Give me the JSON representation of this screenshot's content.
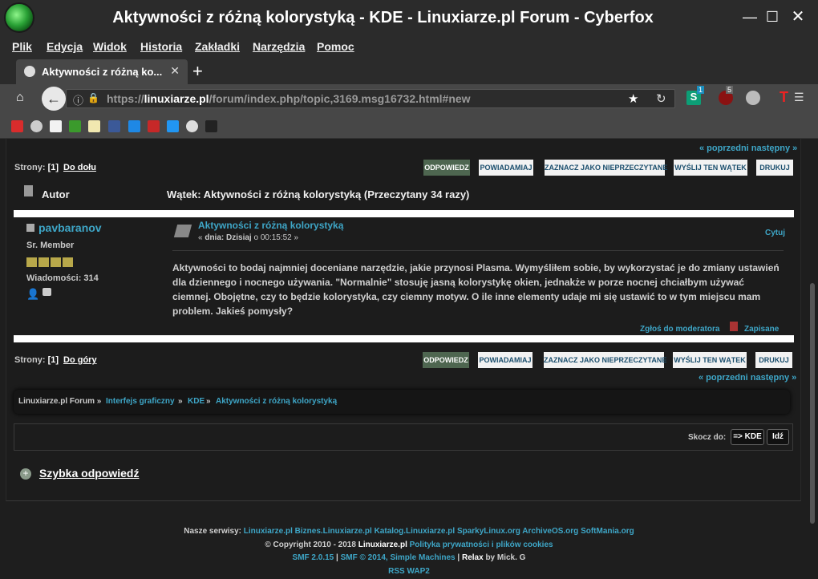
{
  "window": {
    "title": "Aktywności z różną kolorystyką - KDE - Linuxiarze.pl Forum - Cyberfox"
  },
  "menu": [
    "Plik",
    "Edycja",
    "Widok",
    "Historia",
    "Zakładki",
    "Narzędzia",
    "Pomoc"
  ],
  "tab": {
    "label": "Aktywności z różną ko...",
    "close": "✕",
    "new": "+"
  },
  "url": {
    "prefix": "https://",
    "host": "linuxiarze.pl",
    "path": "/forum/index.php/topic,3169.msg16732.html#new"
  },
  "extensions": {
    "badge1": "1",
    "badge2": "5"
  },
  "nav_links": {
    "prev_next": "« poprzedni następny »"
  },
  "pages": {
    "label": "Strony:",
    "current": "[1]",
    "down": "Do dołu",
    "up": "Do góry"
  },
  "buttons": [
    "ODPOWIEDZ",
    "POWIADAMIAJ",
    "ZAZNACZ JAKO NIEPRZECZYTANE",
    "WYŚLIJ TEN WĄTEK",
    "DRUKUJ"
  ],
  "thread": {
    "author_header": "Autor",
    "title": "Wątek: Aktywności z różną kolorystyką  (Przeczytany 34 razy)"
  },
  "post": {
    "author": "pavbaranov",
    "rank": "Sr. Member",
    "messages": "Wiadomości: 314",
    "subject": "Aktywności z różną kolorystyką",
    "date_prefix": "« ",
    "date_bold": "dnia: Dzisiaj",
    "date_rest": " o 00:15:52 »",
    "quote": "Cytuj",
    "body": "Aktywności to bodaj najmniej doceniane narzędzie, jakie przynosi Plasma. Wymyśliłem sobie, by wykorzystać je do zmiany ustawień dla dziennego i nocnego używania. \"Normalnie\" stosuję jasną kolorystykę okien, jednakże w porze nocnej chciałbym używać ciemnej. Obojętne, czy to będzie kolorystyka, czy ciemny motyw. O ile inne elementy udaje mi się ustawić to w tym miejscu mam problem. Jakieś pomysły?",
    "report": "Zgłoś do moderatora",
    "logged": "Zapisane"
  },
  "breadcrumb": {
    "root": "Linuxiarze.pl Forum »",
    "items": [
      "Interfejs graficzny",
      "»",
      "KDE",
      "»",
      "Aktywności z różną kolorystyką"
    ]
  },
  "jump": {
    "label": "Skocz do:",
    "select": "=> KDE",
    "go": "Idź"
  },
  "quick_reply": "Szybka odpowiedź",
  "footer": {
    "sites_label": "Nasze serwisy:",
    "sites": [
      "Linuxiarze.pl",
      "Biznes.Linuxiarze.pl",
      "Katalog.Linuxiarze.pl",
      "SparkyLinux.org",
      "ArchiveOS.org",
      "SoftMania.org"
    ],
    "copyright": "© Copyright 2010 - 2018",
    "brand": "Linuxiarze.pl",
    "privacy": "Polityka prywatności i plików cookies",
    "smf": "SMF 2.0.15",
    "sep": "|",
    "smf2": "SMF © 2014,",
    "sm": "Simple Machines",
    "relax": "Relax",
    "by": "by Mick. G",
    "rss": "RSS",
    "wap": "WAP2"
  },
  "colors": {
    "link": "#3ea6c7",
    "primary_button": "#4e6650",
    "background": "#1b1b1b"
  }
}
